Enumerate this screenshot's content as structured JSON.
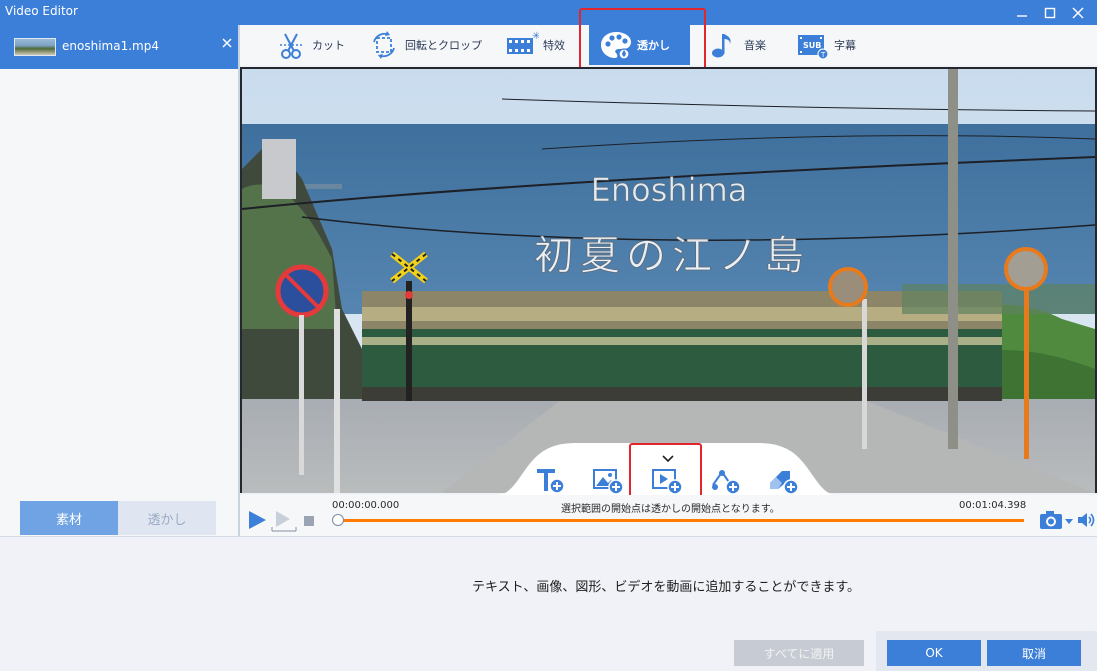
{
  "window": {
    "title": "Video Editor"
  },
  "file": {
    "name": "enoshima1.mp4"
  },
  "left_tabs": {
    "material": "素材",
    "watermark": "透かし"
  },
  "toolbar": {
    "tools": [
      {
        "label": "カット",
        "icon": "scissors-icon"
      },
      {
        "label": "回転とクロップ",
        "icon": "rotate-crop-icon"
      },
      {
        "label": "特效",
        "icon": "effects-icon"
      },
      {
        "label": "透かし",
        "icon": "watermark-palette-icon",
        "active": true
      },
      {
        "label": "音楽",
        "icon": "music-note-icon"
      },
      {
        "label": "字幕",
        "icon": "subtitle-icon"
      }
    ]
  },
  "video": {
    "title_en": "Enoshima",
    "title_jp": "初夏の江ノ島"
  },
  "watermark_tools": [
    "add-text-icon",
    "add-image-icon",
    "add-video-icon",
    "add-shape-icon",
    "add-eraser-icon"
  ],
  "timeline": {
    "start": "00:00:00.000",
    "end": "00:01:04.398",
    "message": "選択範囲の開始点は透かしの開始点となります。",
    "progress": 0.0
  },
  "bottom": {
    "hint": "テキスト、画像、図形、ビデオを動画に追加することができます。",
    "apply_all": "すべてに適用",
    "ok": "OK",
    "cancel": "取消"
  },
  "colors": {
    "accent": "#3c7fd8",
    "highlight": "#e2262b",
    "progress": "#ff7a00"
  }
}
